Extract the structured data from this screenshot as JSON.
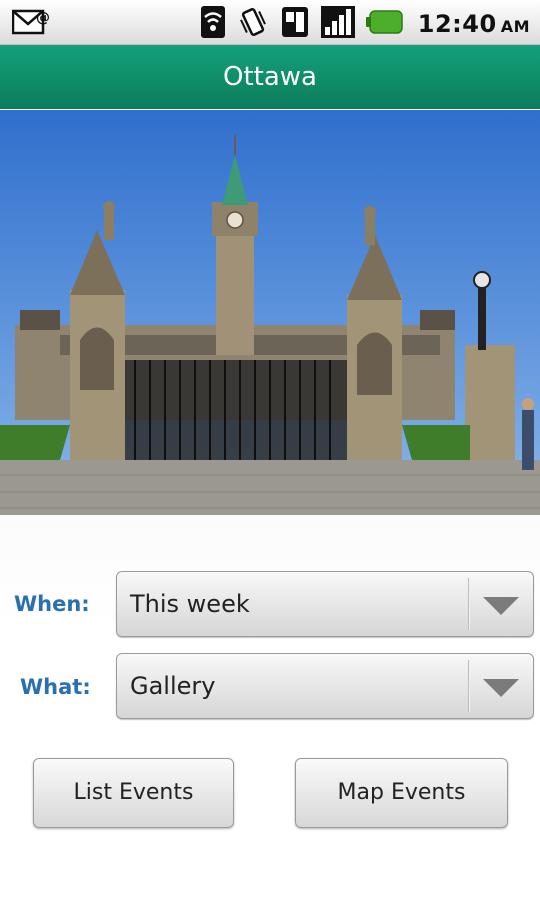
{
  "status_bar": {
    "time": "12:40",
    "ampm": "AM",
    "icons": [
      "email-notification-icon",
      "wifi-icon",
      "vibrate-icon",
      "sd-card-icon",
      "signal-icon",
      "battery-icon"
    ]
  },
  "app": {
    "title": "Ottawa"
  },
  "hero": {
    "image": "parliament-hill-photo"
  },
  "form": {
    "when_label": "When:",
    "when_value": "This week",
    "what_label": "What:",
    "what_value": "Gallery"
  },
  "buttons": {
    "list_events": "List Events",
    "map_events": "Map Events"
  },
  "colors": {
    "title_bar": "#0f8f6a",
    "label": "#2a6fb0"
  }
}
